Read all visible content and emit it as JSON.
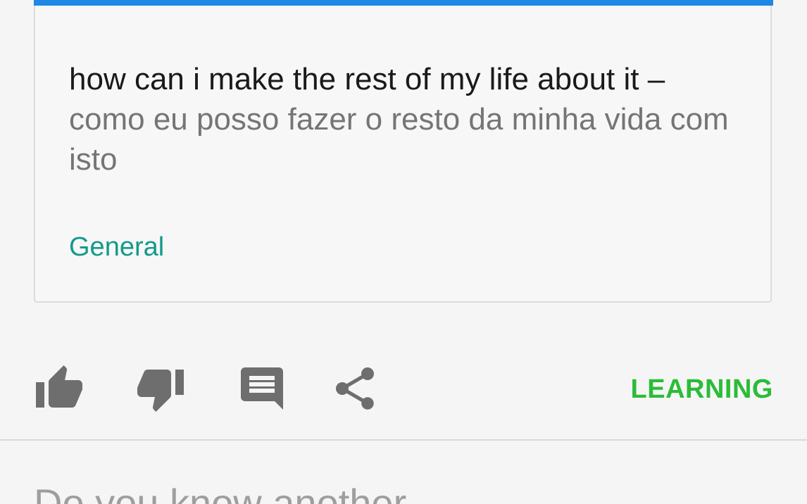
{
  "card": {
    "sentence": "how can i make the rest of my life about it –",
    "translation": "como eu posso fazer o resto da minha vida com isto",
    "category": "General",
    "accent_color": "#1e88e5"
  },
  "actions": {
    "like_icon": "thumb-up-icon",
    "dislike_icon": "thumb-down-icon",
    "comment_icon": "comment-icon",
    "share_icon": "share-icon",
    "status_label": "LEARNING",
    "status_color": "#2bbc39"
  },
  "prompt": {
    "text": "Do you know another"
  }
}
